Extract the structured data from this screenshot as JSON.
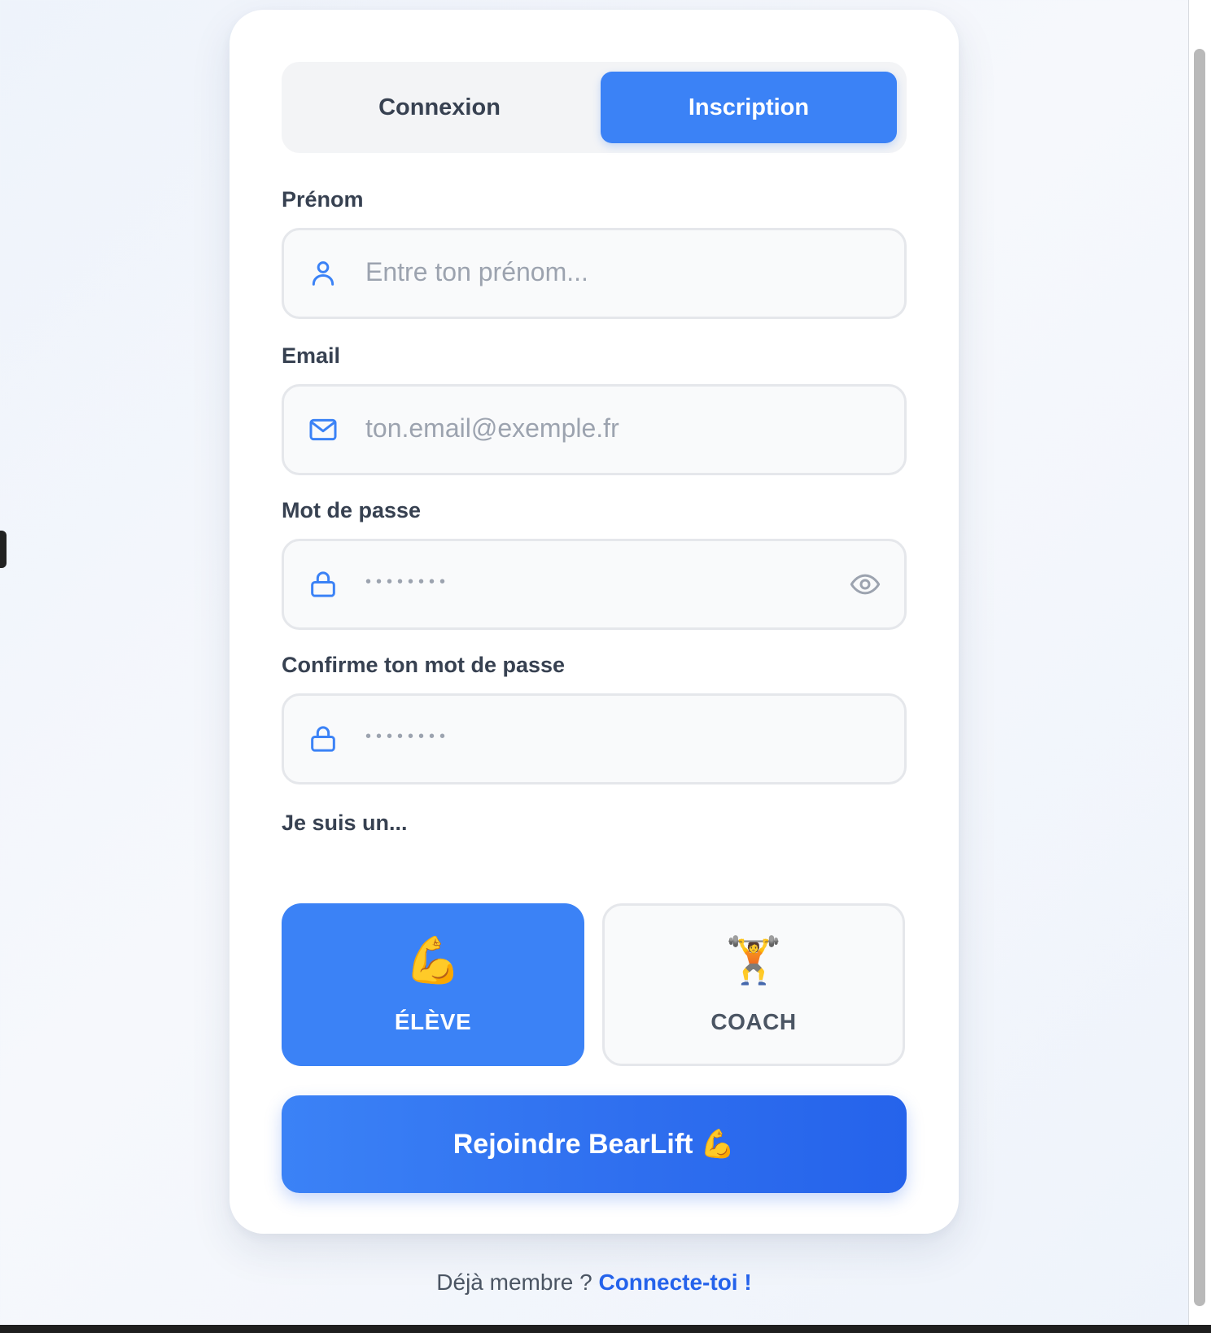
{
  "tabs": {
    "login_label": "Connexion",
    "signup_label": "Inscription",
    "active": "signup"
  },
  "form": {
    "first_name": {
      "label": "Prénom",
      "placeholder": "Entre ton prénom...",
      "icon": "user-icon"
    },
    "email": {
      "label": "Email",
      "placeholder": "ton.email@exemple.fr",
      "icon": "mail-icon"
    },
    "password": {
      "label": "Mot de passe",
      "placeholder_dots": "••••••••",
      "icon": "lock-icon",
      "toggle_icon": "eye-icon"
    },
    "confirm_password": {
      "label": "Confirme ton mot de passe",
      "placeholder_dots": "••••••••",
      "icon": "lock-icon"
    },
    "role": {
      "label": "Je suis un...",
      "options": [
        {
          "label": "ÉLÈVE",
          "emoji": "💪",
          "selected": true
        },
        {
          "label": "COACH",
          "emoji": "🏋️",
          "selected": false
        }
      ]
    },
    "submit_label": "Rejoindre BearLift 💪"
  },
  "footer": {
    "text": "Déjà membre ?",
    "link": "Connecte-toi !"
  },
  "colors": {
    "accent": "#3b82f6",
    "accent_dark": "#2563eb",
    "field_bg": "#f9fafb",
    "field_border": "#e5e7eb",
    "text": "#374151",
    "placeholder": "#9ca3af"
  }
}
